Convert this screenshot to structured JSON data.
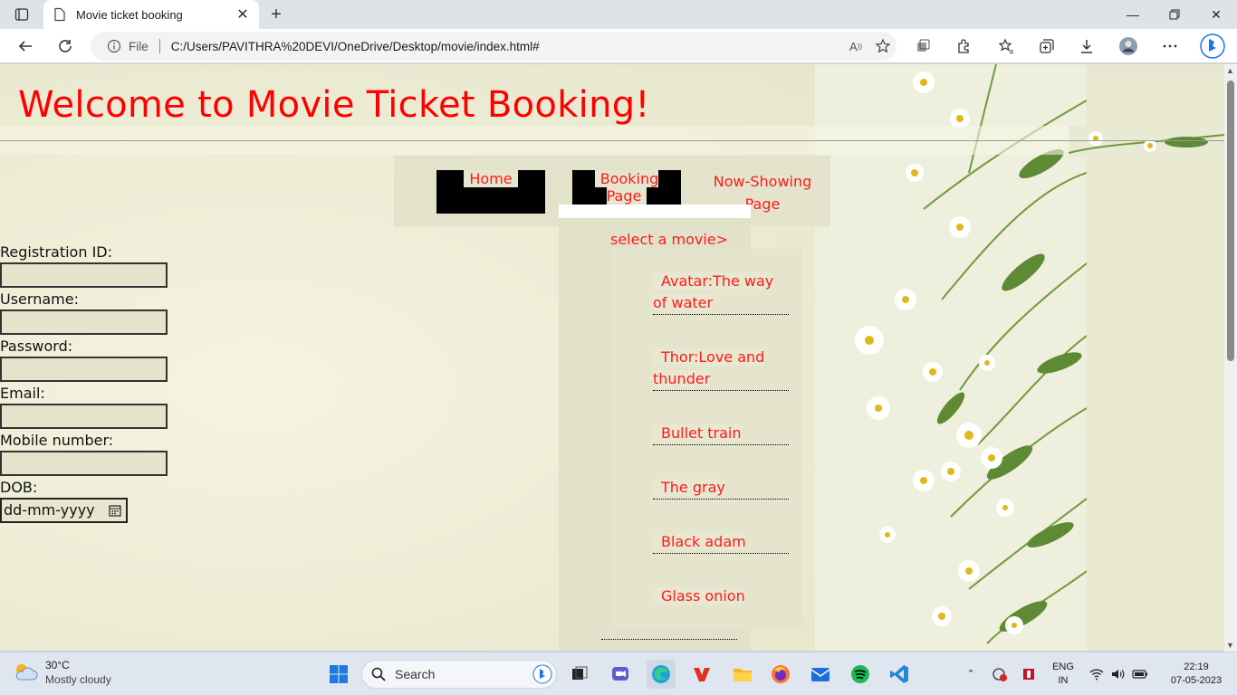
{
  "browser": {
    "tab_title": "Movie ticket booking",
    "address_prefix": "File",
    "url": "C:/Users/PAVITHRA%20DEVI/OneDrive/Desktop/movie/index.html#"
  },
  "page": {
    "title": "Welcome to Movie Ticket Booking!",
    "nav": {
      "home": "Home",
      "booking": "Booking Page",
      "now_showing": "Now-Showing Page"
    },
    "dropdown": {
      "label": "select a movie>",
      "movies": [
        "Avatar:The way of water",
        "Thor:Love and thunder",
        "Bullet train",
        "The gray",
        "Black adam",
        "Glass onion"
      ]
    },
    "form": {
      "registration_id": "Registration ID:",
      "username": "Username:",
      "password": "Password:",
      "email": "Email:",
      "mobile": "Mobile number:",
      "dob": "DOB:",
      "dob_placeholder": "dd-mm-yyyy"
    }
  },
  "taskbar": {
    "temperature": "30°C",
    "weather": "Mostly cloudy",
    "search_label": "Search",
    "language_top": "ENG",
    "language_bottom": "IN",
    "time": "22:19",
    "date": "07-05-2023"
  },
  "colors": {
    "accent_red": "#ff0000",
    "page_bg": "#efefd9"
  }
}
